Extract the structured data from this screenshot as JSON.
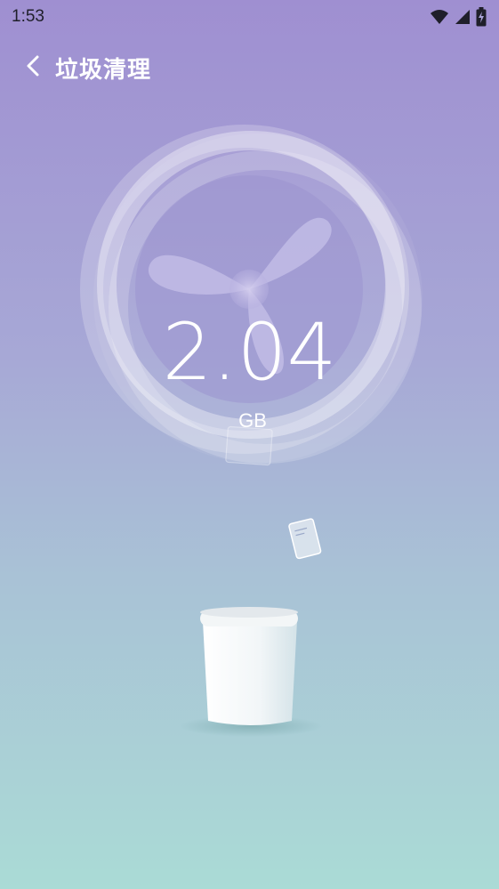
{
  "status_bar": {
    "time": "1:53",
    "icons": [
      "wifi-icon",
      "cellular-signal-icon",
      "battery-charging-icon"
    ]
  },
  "header": {
    "title": "垃圾清理",
    "back_icon": "chevron-left-icon"
  },
  "scan": {
    "size_value": "2.04",
    "size_unit": "GB"
  },
  "colors": {
    "background_top": "#9f8fd1",
    "background_bottom": "#aadbd6",
    "text": "#ffffff"
  }
}
